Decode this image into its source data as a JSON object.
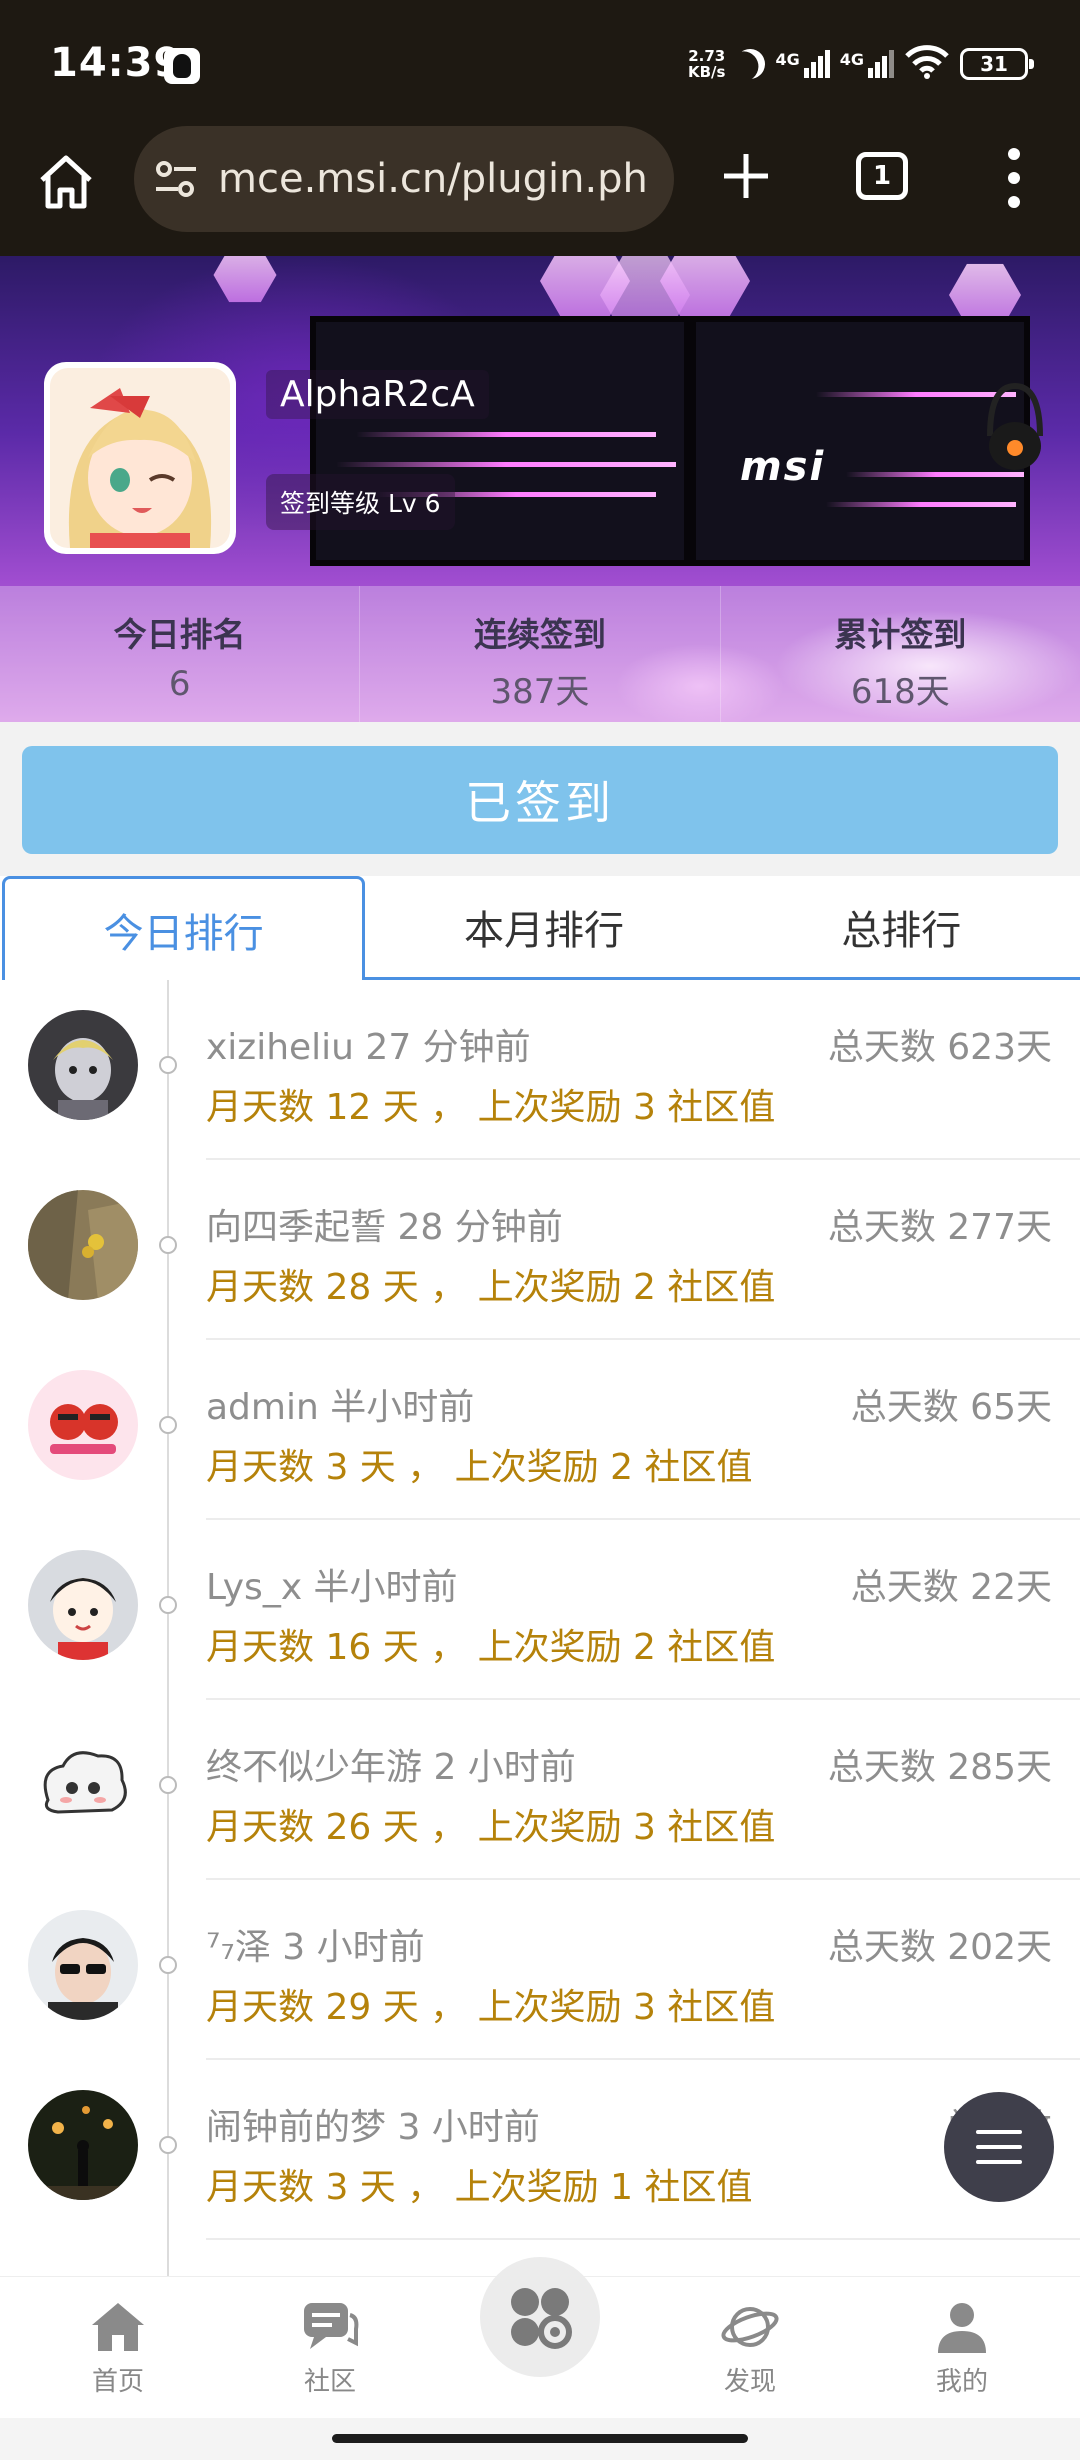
{
  "status_bar": {
    "time": "14:39",
    "speed_value": "2.73",
    "speed_unit": "KB/s",
    "network_1": "4G",
    "network_2": "4G",
    "battery": "31"
  },
  "browser": {
    "url": "mce.msi.cn/plugin.ph",
    "tab_count": "1"
  },
  "profile": {
    "username": "AlphaR2cA",
    "level": "签到等级 Lv 6",
    "hero_brand": "msi"
  },
  "stats": [
    {
      "label": "今日排名",
      "value": "6"
    },
    {
      "label": "连续签到",
      "value": "387天"
    },
    {
      "label": "累计签到",
      "value": "618天"
    }
  ],
  "signed_button": "已签到",
  "tabs": [
    {
      "label": "今日排行",
      "active": true
    },
    {
      "label": "本月排行",
      "active": false
    },
    {
      "label": "总排行",
      "active": false
    }
  ],
  "rows": [
    {
      "name": "xiziheliu 27 分钟前",
      "total": "总天数 623天",
      "meta": "月天数 12 天 ，  上次奖励 3 社区值"
    },
    {
      "name": "向四季起誓 28 分钟前",
      "total": "总天数 277天",
      "meta": "月天数 28 天 ，  上次奖励 2 社区值"
    },
    {
      "name": "admin 半小时前",
      "total": "总天数 65天",
      "meta": "月天数 3 天 ，  上次奖励 2 社区值"
    },
    {
      "name": "Lys_x 半小时前",
      "total": "总天数 22天",
      "meta": "月天数 16 天 ，  上次奖励 2 社区值"
    },
    {
      "name": "终不似少年游 2 小时前",
      "total": "总天数 285天",
      "meta": "月天数 26 天 ，  上次奖励 3 社区值"
    },
    {
      "name": "⁷₇泽 3 小时前",
      "total": "总天数 202天",
      "meta": "月天数 29 天 ，  上次奖励 3 社区值"
    },
    {
      "name": "闹钟前的梦 3 小时前",
      "total": "总天数 ",
      "meta": "月天数 3 天 ，  上次奖励 1 社区值"
    }
  ],
  "bottom_nav": [
    {
      "label": "首页",
      "icon": "home-icon"
    },
    {
      "label": "社区",
      "icon": "chat-icon"
    },
    {
      "label": "",
      "icon": "apps-icon"
    },
    {
      "label": "发现",
      "icon": "planet-icon"
    },
    {
      "label": "我的",
      "icon": "user-icon"
    }
  ],
  "colors": {
    "accent": "#4a90e2",
    "signed_button": "#7fc3ec",
    "meta_text": "#b5820a"
  }
}
